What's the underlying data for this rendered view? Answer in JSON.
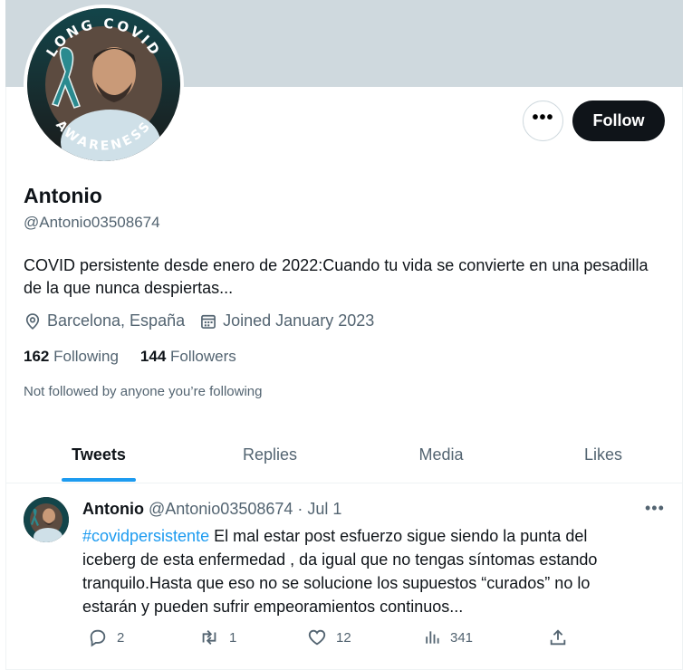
{
  "profile": {
    "avatar_ring_text_top": "LONG COVID",
    "avatar_ring_text_bottom": "AWARENESS",
    "name": "Antonio",
    "handle": "@Antonio03508674",
    "bio": "COVID persistente desde enero de 2022:Cuando tu vida se convierte en una pesadilla de la que nunca despiertas...",
    "location": "Barcelona, España",
    "joined": "Joined January 2023",
    "following_count": "162",
    "following_label": "Following",
    "followers_count": "144",
    "followers_label": "Followers",
    "not_followed_note": "Not followed by anyone you’re following"
  },
  "buttons": {
    "more_label": "•••",
    "follow_label": "Follow"
  },
  "tabs": [
    {
      "label": "Tweets",
      "active": true
    },
    {
      "label": "Replies",
      "active": false
    },
    {
      "label": "Media",
      "active": false
    },
    {
      "label": "Likes",
      "active": false
    }
  ],
  "tweet": {
    "author": "Antonio",
    "handle": "@Antonio03508674",
    "separator": "·",
    "date": "Jul 1",
    "more_label": "•••",
    "hashtag": "#covidpersistente",
    "text": " El mal estar post esfuerzo sigue siendo la punta del iceberg de esta enfermedad , da igual que no tengas síntomas estando tranquilo.Hasta que eso no se solucione los supuestos “curados” no lo estarán y pueden sufrir empeoramientos continuos...",
    "replies": "2",
    "retweets": "1",
    "likes": "12",
    "views": "341"
  },
  "colors": {
    "accent": "#1d9bf0",
    "banner": "#cfd9de",
    "text_secondary": "#536471",
    "awareness_ribbon": "#2a8a8f"
  },
  "icons": {
    "location": "location-pin-icon",
    "calendar": "calendar-icon",
    "reply": "reply-bubble-icon",
    "retweet": "retweet-icon",
    "like": "heart-icon",
    "views": "bar-chart-icon",
    "share": "share-upload-icon"
  }
}
